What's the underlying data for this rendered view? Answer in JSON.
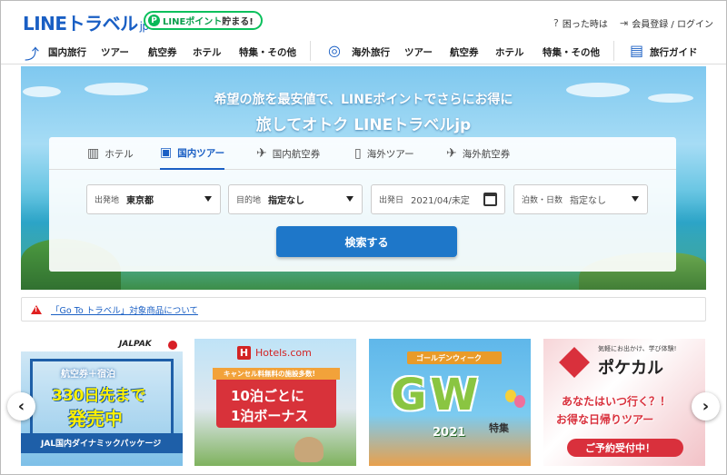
{
  "header": {
    "logo_main": "LINEトラベル",
    "logo_suffix": "jp",
    "point_badge_icon": "P",
    "point_badge_green": "LINEポイント",
    "point_badge_dark": "貯まる!",
    "help_label": "困った時は",
    "account_label": "会員登録 / ログイン"
  },
  "nav": {
    "domestic": "国内旅行",
    "domestic_tour": "ツアー",
    "domestic_air": "航空券",
    "domestic_hotel": "ホテル",
    "domestic_special": "特集・その他",
    "overseas": "海外旅行",
    "overseas_tour": "ツアー",
    "overseas_air": "航空券",
    "overseas_hotel": "ホテル",
    "overseas_special": "特集・その他",
    "guide": "旅行ガイド"
  },
  "hero": {
    "tagline1": "希望の旅を最安値で、LINEポイントでさらにお得に",
    "tagline2": "旅してオトク LINEトラベルjp"
  },
  "search": {
    "tabs": [
      {
        "label": "ホテル"
      },
      {
        "label": "国内ツアー"
      },
      {
        "label": "国内航空券"
      },
      {
        "label": "海外ツアー"
      },
      {
        "label": "海外航空券"
      }
    ],
    "departure_label": "出発地",
    "departure_value": "東京都",
    "destination_label": "目的地",
    "destination_value": "指定なし",
    "date_label": "出発日",
    "date_value": "2021/04/未定",
    "nights_label": "泊数・日数",
    "nights_value": "指定なし",
    "submit": "検索する"
  },
  "notice": {
    "text": "「Go To トラベル」対象商品について"
  },
  "banners": {
    "b1": {
      "brand": "JALPAK",
      "line1": "航空券＋宿泊",
      "line2": "330日先まで",
      "line3": "発売中",
      "line4": "JAL国内ダイナミックパッケージ"
    },
    "b2": {
      "brand": "Hotels.com",
      "line1": "キャンセル料無料の施設多数!",
      "line2": "10泊ごとに",
      "line3": "1泊ボーナス"
    },
    "b3": {
      "line1": "ゴールデンウィーク",
      "line2": "GW",
      "line3": "2021",
      "line4": "特集"
    },
    "b4": {
      "line1": "気軽にお出かけ、学び体験!",
      "line2": "ポケカル",
      "line3": "あなたはいつ行く？！",
      "line4": "お得な日帰りツアー",
      "line5": "ご予約受付中！"
    }
  },
  "carousel": {
    "prev": "‹",
    "next": "›"
  }
}
